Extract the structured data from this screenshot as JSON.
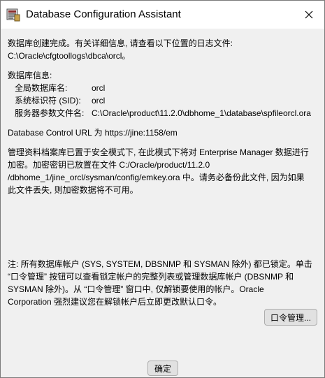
{
  "window": {
    "title": "Database Configuration Assistant"
  },
  "message": {
    "intro": [
      "数据库创建完成。有关详细信息, 请查看以下位置的日志文件:",
      " C:\\Oracle\\cfgtoollogs\\dbca\\orcl。"
    ],
    "db_info_heading": "数据库信息:",
    "db_info": [
      {
        "label": "全局数据库名:",
        "value": "orcl"
      },
      {
        "label": "系统标识符 (SID):",
        "value": "orcl"
      },
      {
        "label": "服务器参数文件名:",
        "value": "C:\\Oracle\\product\\11.2.0\\dbhome_1\\database\\spfileorcl.ora"
      }
    ],
    "dbcontrol_url": "Database Control URL 为 https://jine:1158/em",
    "secure_mode": [
      "管理资料档案库已置于安全模式下, 在此模式下将对 Enterprise Manager 数据进行",
      "加密。加密密钥已放置在文件 C:/Oracle/product/11.2.0",
      "/dbhome_1/jine_orcl/sysman/config/emkey.ora 中。请务必备份此文件, 因为如果",
      "此文件丢失, 则加密数据将不可用。"
    ],
    "note": [
      "注: 所有数据库帐户 (SYS, SYSTEM, DBSNMP 和 SYSMAN 除外) 都已锁定。单击",
      "“口令管理” 按钮可以查看锁定帐户的完整列表或管理数据库帐户 (DBSNMP 和",
      "SYSMAN 除外)。从 “口令管理” 窗口中, 仅解锁要使用的帐户。Oracle",
      "Corporation 强烈建议您在解锁帐户后立即更改默认口令。"
    ]
  },
  "buttons": {
    "password_management": "口令管理...",
    "ok": "确定"
  }
}
